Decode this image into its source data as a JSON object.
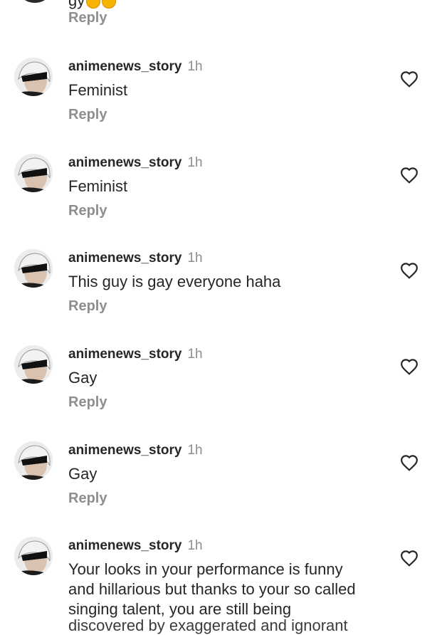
{
  "partial_top": {
    "text_fragment": "gy",
    "reply_label": "Reply"
  },
  "comments": [
    {
      "username": "animenews_story",
      "time": "1h",
      "text": "Feminist",
      "reply_label": "Reply",
      "avatar": "avatar-icon",
      "like_icon": "heart-outline-icon"
    },
    {
      "username": "animenews_story",
      "time": "1h",
      "text": "Feminist",
      "reply_label": "Reply",
      "avatar": "avatar-icon",
      "like_icon": "heart-outline-icon"
    },
    {
      "username": "animenews_story",
      "time": "1h",
      "text": "This guy is gay everyone haha",
      "reply_label": "Reply",
      "avatar": "avatar-icon",
      "like_icon": "heart-outline-icon"
    },
    {
      "username": "animenews_story",
      "time": "1h",
      "text": "Gay",
      "reply_label": "Reply",
      "avatar": "avatar-icon",
      "like_icon": "heart-outline-icon"
    },
    {
      "username": "animenews_story",
      "time": "1h",
      "text": "Gay",
      "reply_label": "Reply",
      "avatar": "avatar-icon",
      "like_icon": "heart-outline-icon"
    },
    {
      "username": "animenews_story",
      "time": "1h",
      "text": "Your looks in your performance is funny\nand hillarious but thanks to your so called\nsinging talent, you are still being",
      "avatar": "avatar-icon",
      "like_icon": "heart-outline-icon"
    }
  ],
  "bottom_cut_text": "discovered by exaggerated and ignorant",
  "colors": {
    "text_primary": "#262626",
    "text_secondary": "#8e8e8e",
    "background": "#ffffff"
  }
}
